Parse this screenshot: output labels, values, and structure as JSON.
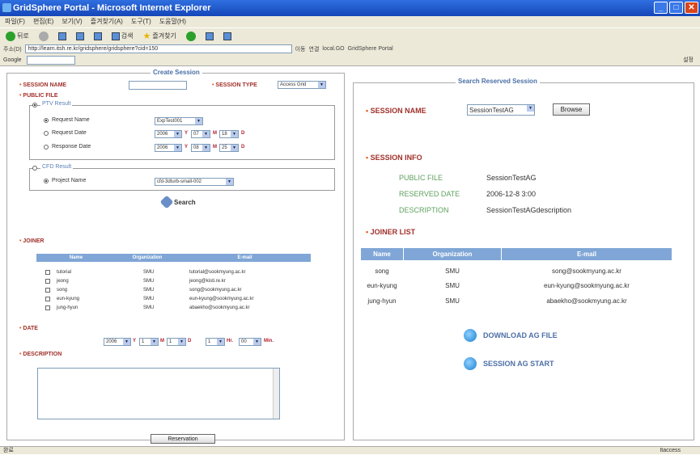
{
  "window": {
    "title": "GridSphere Portal - Microsoft Internet Explorer",
    "min": "_",
    "max": "□",
    "close": "✕"
  },
  "menu": [
    "파일(F)",
    "편집(E)",
    "보기(V)",
    "즐겨찾기(A)",
    "도구(T)",
    "도움말(H)"
  ],
  "toolbar": {
    "back": "뒤로",
    "search": "검색",
    "favorites": "즐겨찾기"
  },
  "address": {
    "label": "주소(D)",
    "url": "http://learn.itsh.re.kr/gridsphere/gridsphere?cid=150",
    "go": "이동",
    "links": "연결",
    "link1": "local.GO",
    "link2": "GridSphere Portal"
  },
  "google": {
    "label": "Google",
    "settings": "설정"
  },
  "left": {
    "legend": "Create Session",
    "session_name": "SESSION NAME",
    "session_type": "SESSION TYPE",
    "session_type_value": "Access Grid",
    "public_file": "PUBLIC FILE",
    "ptv": {
      "legend": "PTV Result",
      "r1": "Request Name",
      "r1_value": "ExpTest001",
      "r2": "Request Date",
      "r3": "Response Date",
      "d1": {
        "y": "2006",
        "m": "07",
        "d": "18"
      },
      "d2": {
        "y": "2006",
        "m": "08",
        "d": "25"
      }
    },
    "cfd": {
      "legend": "CFD Result",
      "r1": "Project Name",
      "r1_value": "cfd-3dturb-small-002"
    },
    "units": {
      "y": "Y",
      "m": "M",
      "d": "D",
      "hr": "Hr.",
      "min": "Min."
    },
    "search": "Search",
    "joiner": "JOINER",
    "headers": [
      "Name",
      "Organization",
      "E-mail"
    ],
    "rows": [
      {
        "name": "tutorial",
        "org": "SMU",
        "email": "tutorial@sookmyung.ac.kr"
      },
      {
        "name": "jeong",
        "org": "SMU",
        "email": "jeong@kisti.re.kr"
      },
      {
        "name": "song",
        "org": "SMU",
        "email": "song@sookmyung.ac.kr"
      },
      {
        "name": "eun-kyung",
        "org": "SMU",
        "email": "eun-kyung@sookmyung.ac.kr"
      },
      {
        "name": "jung-hyun",
        "org": "SMU",
        "email": "abaekho@sookmyung.ac.kr"
      }
    ],
    "date": "DATE",
    "date_vals": {
      "y": "2006",
      "m": "1",
      "d": "1",
      "hr": "1",
      "min": "00"
    },
    "description": "DESCRIPTION",
    "reservation": "Reservation"
  },
  "right": {
    "legend": "Search Reserved Session",
    "session_name": "SESSION NAME",
    "session_value": "SessionTestAG",
    "browse": "Browse",
    "info": "SESSION INFO",
    "public_file_k": "PUBLIC FILE",
    "public_file_v": "SessionTestAG",
    "reserved_k": "RESERVED DATE",
    "reserved_v": "2006-12-8 3:00",
    "desc_k": "DESCRIPTION",
    "desc_v": "SessionTestAGdescription",
    "joiner_list": "JOINER LIST",
    "headers": [
      "Name",
      "Organization",
      "E-mail"
    ],
    "rows": [
      {
        "name": "song",
        "org": "SMU",
        "email": "song@sookmyung.ac.kr"
      },
      {
        "name": "eun-kyung",
        "org": "SMU",
        "email": "eun-kyung@sookmyung.ac.kr"
      },
      {
        "name": "jung-hyun",
        "org": "SMU",
        "email": "abaekho@sookmyung.ac.kr"
      }
    ],
    "download": "DOWNLOAD AG FILE",
    "start": "SESSION AG START"
  },
  "status": {
    "left": "완료",
    "right": "Itaccess"
  }
}
